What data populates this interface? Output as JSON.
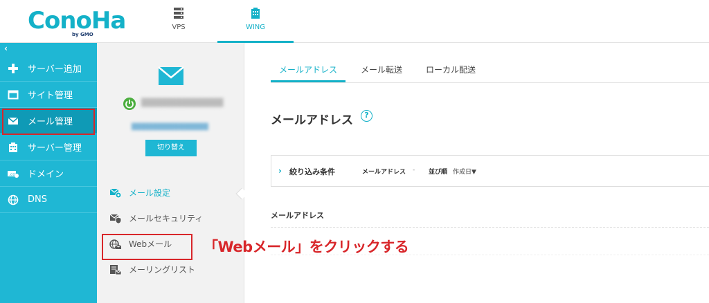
{
  "brand": {
    "logo_text": "ConoHa",
    "logo_sub": "by GMO"
  },
  "top_tabs": [
    {
      "label": "VPS",
      "icon": "server-icon"
    },
    {
      "label": "WING",
      "icon": "building-icon",
      "active": true
    }
  ],
  "sidebar": {
    "collapse_label": "‹",
    "items": [
      {
        "label": "サーバー追加",
        "icon": "plus-icon"
      },
      {
        "label": "サイト管理",
        "icon": "window-icon"
      },
      {
        "label": "メール管理",
        "icon": "mail-icon",
        "active": true
      },
      {
        "label": "サーバー管理",
        "icon": "building-icon"
      },
      {
        "label": "ドメイン",
        "icon": "domain-icon"
      },
      {
        "label": "DNS",
        "icon": "globe-icon"
      }
    ]
  },
  "account": {
    "switch_label": "切り替え",
    "status_color": "#4cae3f"
  },
  "mid_menu": [
    {
      "label": "メール設定",
      "icon": "mail-settings-icon",
      "active": true
    },
    {
      "label": "メールセキュリティ",
      "icon": "mail-security-icon"
    },
    {
      "label": "Webメール",
      "icon": "webmail-icon"
    },
    {
      "label": "メーリングリスト",
      "icon": "mailing-list-icon"
    }
  ],
  "content": {
    "sub_tabs": [
      {
        "label": "メールアドレス",
        "active": true
      },
      {
        "label": "メール転送"
      },
      {
        "label": "ローカル配送"
      }
    ],
    "page_title": "メールアドレス",
    "help_symbol": "?",
    "filter": {
      "toggle_label": "絞り込み条件",
      "field_label": "メールアドレス",
      "field_value": "-",
      "sort_label": "並び順",
      "sort_value": "作成日▼"
    },
    "column_header": "メールアドレス"
  },
  "annotation": "「Webメール」をクリックする",
  "colors": {
    "accent": "#1fb7d4",
    "highlight": "#d8262a"
  }
}
